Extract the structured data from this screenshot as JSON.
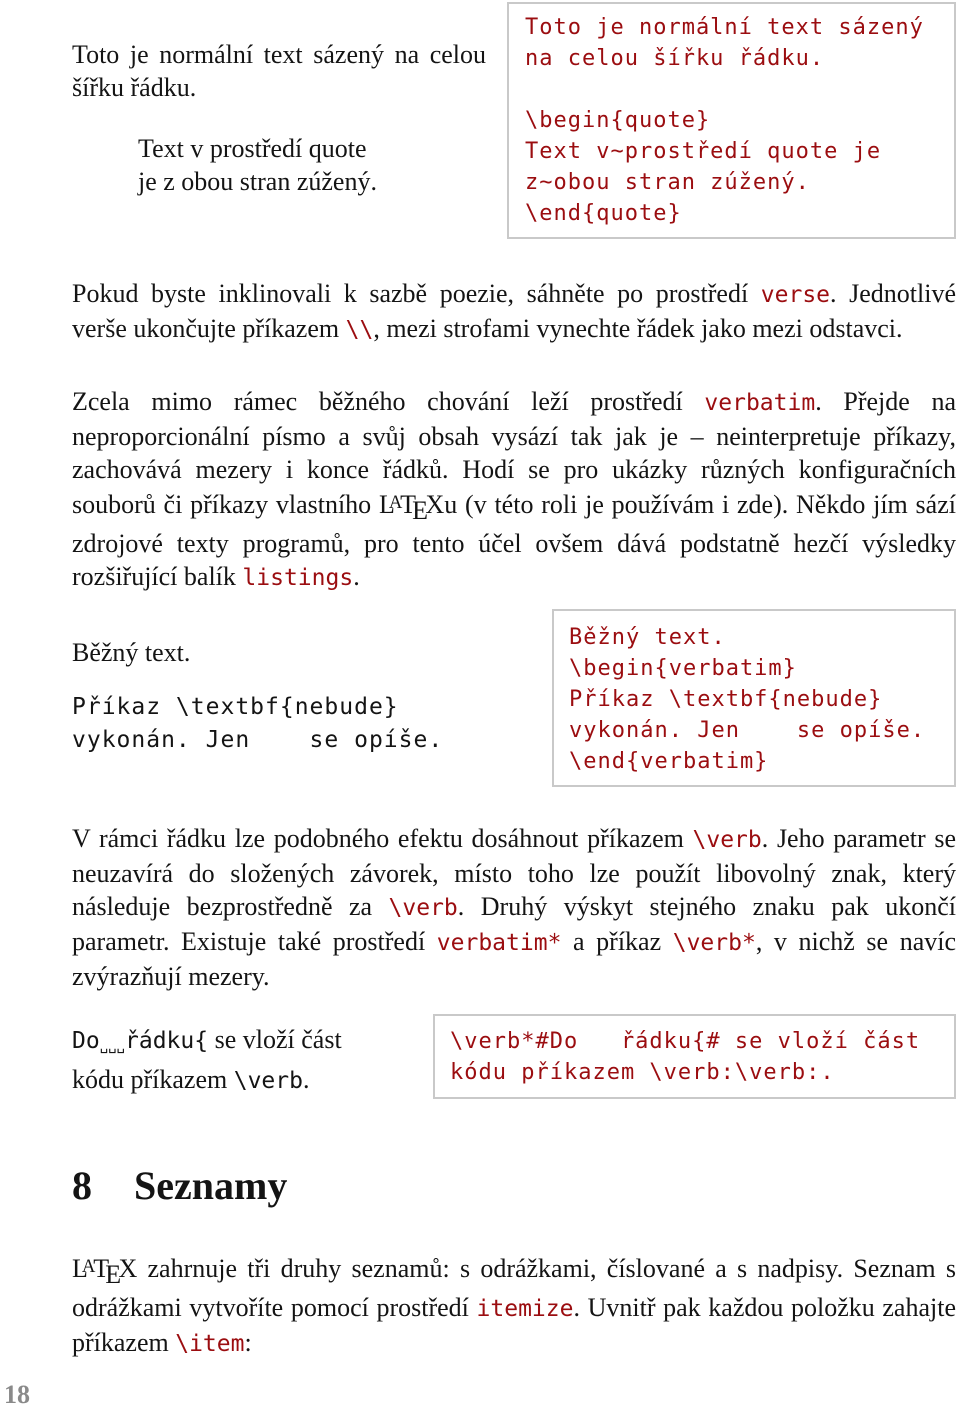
{
  "example1": {
    "output_normal": "Toto je normální text sázený na celou šířku řádku.",
    "output_quote_line1": "Text v prostředí quote",
    "output_quote_line2": "je z obou stran zúžený.",
    "source_lines": [
      "Toto je normální text sázený",
      "na celou šířku řádku.",
      "",
      "\\begin{quote}",
      "Text v~prostředí quote je",
      "z~obou stran zúžený.",
      "\\end{quote}"
    ]
  },
  "para_verse": {
    "t1": "Pokud byste inklinovali k sazbě poezie, sáhněte po prostředí ",
    "c1": "verse",
    "t2": ". Jednotlivé verše ukončujte příkazem ",
    "c2": "\\\\",
    "t3": ", mezi strofami vynechte řádek jako mezi odstavci."
  },
  "para_verbatim": {
    "t1": "Zcela mimo rámec běžného chování leží prostředí ",
    "c1": "verbatim",
    "t2": ". Přejde na neproporcionální písmo a svůj obsah vysází tak jak je – neinterpretuje příkazy, zachovává mezery i konce řádků. Hodí se pro ukázky různých konfiguračních souborů či příkazy vlastního ",
    "t3": "u (v této roli je používám i zde). Někdo jím sází zdrojové texty programů, pro tento účel ovšem dává podstatně hezčí výsledky rozšiřující balík ",
    "c2": "listings",
    "t4": "."
  },
  "example2": {
    "output_text": "Běžný text.",
    "output_verbatim": "Příkaz \\textbf{nebude}\nvykonán. Jen    se opíše.",
    "source": "Běžný text.\n\\begin{verbatim}\nPříkaz \\textbf{nebude}\nvykonán. Jen    se opíše.\n\\end{verbatim}"
  },
  "para_verb": {
    "t1": "V rámci řádku lze podobného efektu dosáhnout příkazem ",
    "c1": "\\verb",
    "t2": ". Jeho parametr se neuzavírá do složených závorek, místo toho lze použít libovolný znak, který následuje bezprostředně za ",
    "c2": "\\verb",
    "t3": ". Druhý výskyt stejného znaku pak ukončí parametr. Existuje také prostředí ",
    "c3": "verbatim*",
    "t4": " a příkaz ",
    "c4": "\\verb*",
    "t5": ", v nichž se navíc zvýrazňují mezery."
  },
  "example3": {
    "out_mono1": "Do",
    "out_spaces": "␣␣␣",
    "out_mono2": "řádku{",
    "out_text1": " se vloží část",
    "out_text2": "kódu příkazem ",
    "out_mono3": "\\verb",
    "out_text3": ".",
    "source": "\\verb*#Do   řádku{# se vloží část\nkódu příkazem \\verb:\\verb:."
  },
  "section": {
    "number": "8",
    "title": "Seznamy"
  },
  "para_lists": {
    "t1": " zahrnuje tři druhy seznamů: s odrážkami, číslované a s nadpisy. Seznam s odrážkami vytvoříte pomocí prostředí ",
    "c1": "itemize",
    "t2": ". Uvnitř pak každou položku zahajte příkazem ",
    "c2": "\\item",
    "t3": ":"
  },
  "latex_logo": {
    "l": "L",
    "a": "A",
    "t": "T",
    "e": "E",
    "x": "X"
  },
  "page_number": "18"
}
